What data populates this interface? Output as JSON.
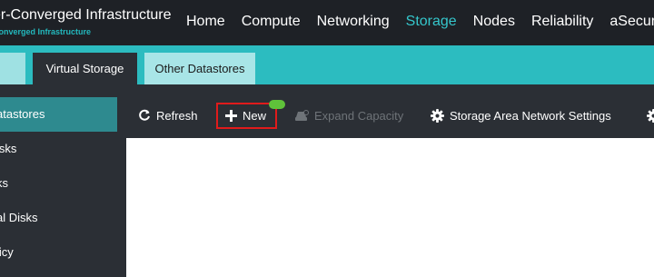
{
  "brand": {
    "title": "er-Converged Infrastructure",
    "subtitle": "Converged Infrastructure"
  },
  "nav": {
    "items": [
      "Home",
      "Compute",
      "Networking",
      "Storage",
      "Nodes",
      "Reliability",
      "aSecuri"
    ],
    "active": "Storage"
  },
  "tabs": {
    "virtual": "Virtual Storage",
    "other": "Other Datastores"
  },
  "sidebar": {
    "items": [
      "atastores",
      "isks",
      "ks",
      "al Disks",
      "licy"
    ],
    "active": "atastores"
  },
  "toolbar": {
    "refresh": "Refresh",
    "new": "New",
    "expand": "Expand Capacity",
    "san": "Storage Area Network Settings"
  },
  "colors": {
    "accent": "#2cbcc0",
    "nav_active": "#35c6cb",
    "topbar": "#1e2126",
    "panel": "#2b2f35",
    "highlight_border": "#e01b1b",
    "badge": "#5fc23a"
  }
}
